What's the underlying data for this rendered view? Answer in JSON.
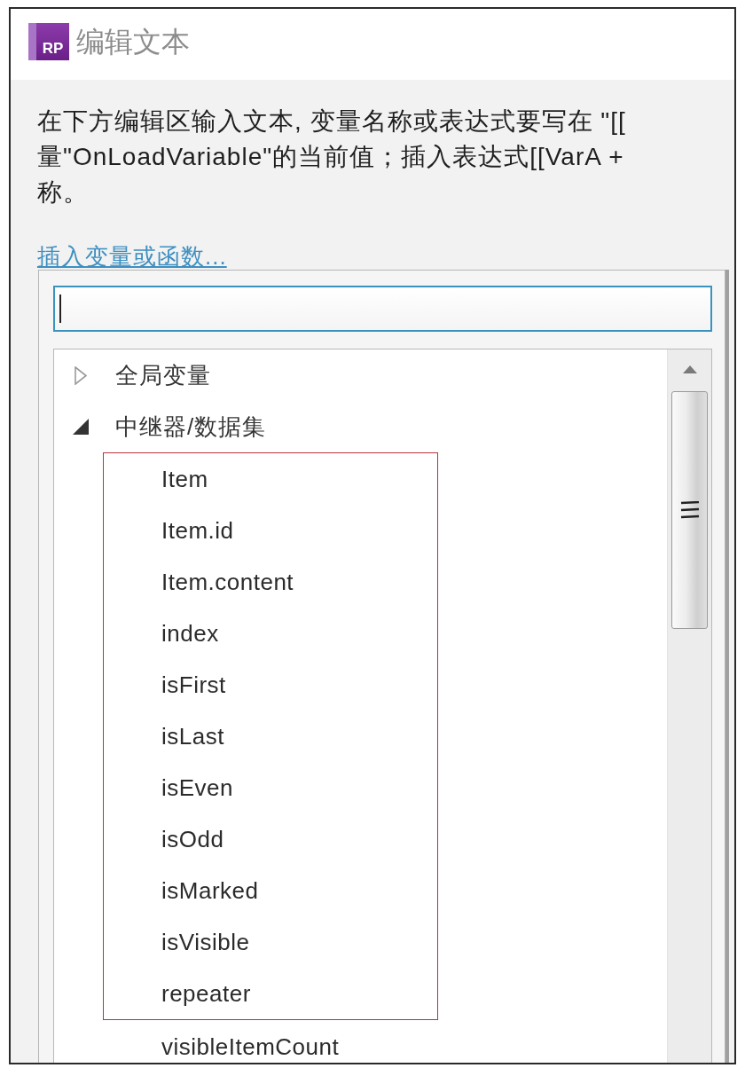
{
  "window": {
    "logo": "RP",
    "title": "编辑文本"
  },
  "instructions": [
    "在下方编辑区输入文本, 变量名称或表达式要写在 \"[[",
    "量\"OnLoadVariable\"的当前值；插入表达式[[VarA +",
    "称。"
  ],
  "insert_link": "插入变量或函数...",
  "popup": {
    "search": {
      "focused": true
    },
    "tree": [
      {
        "label": "全局变量",
        "expanded": false
      },
      {
        "label": "中继器/数据集",
        "expanded": true,
        "sections": [
          {
            "highlighted": true,
            "items": [
              {
                "label": "Item"
              },
              {
                "label": "Item.id"
              },
              {
                "label": "Item.content"
              },
              {
                "label": "index"
              },
              {
                "label": "isFirst"
              },
              {
                "label": "isLast"
              },
              {
                "label": "isEven"
              },
              {
                "label": "isOdd"
              },
              {
                "label": "isMarked"
              },
              {
                "label": "isVisible"
              },
              {
                "label": "repeater"
              }
            ]
          },
          {
            "highlighted": false,
            "items": [
              {
                "label": "visibleItemCount"
              }
            ]
          }
        ]
      }
    ]
  }
}
